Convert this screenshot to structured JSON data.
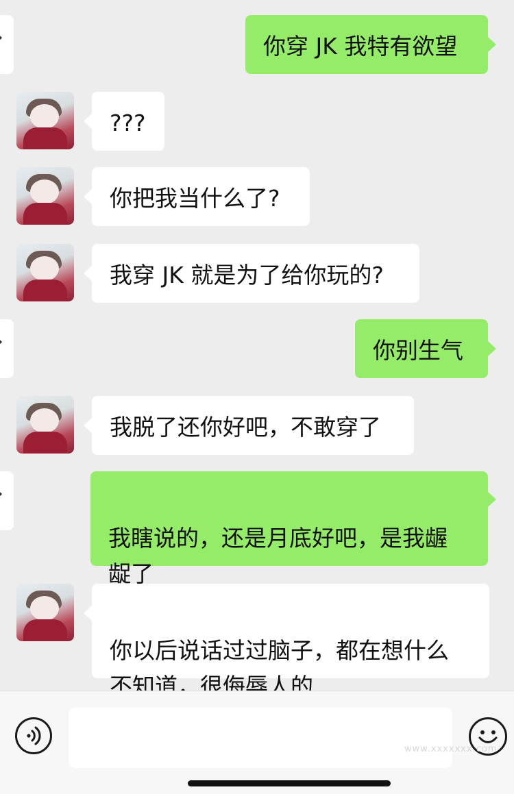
{
  "messages": [
    {
      "sender": "me",
      "text": "你穿 JK 我特有欲望"
    },
    {
      "sender": "other",
      "text": "???"
    },
    {
      "sender": "other",
      "text": "你把我当什么了?"
    },
    {
      "sender": "other",
      "text": "我穿 JK 就是为了给你玩的?"
    },
    {
      "sender": "me",
      "text": "你别生气"
    },
    {
      "sender": "other",
      "text": "我脱了还你好吧，不敢穿了"
    },
    {
      "sender": "me",
      "text": "我瞎说的，还是月底好吧，是我龌\n龊了"
    },
    {
      "sender": "other",
      "text": "你以后说话过过脑子，都在想什么\n不知道，很侮辱人的"
    }
  ],
  "edge_glyph": "❖",
  "input": {
    "placeholder": ""
  },
  "icons": {
    "voice": "voice-icon",
    "emoji": "emoji-icon"
  },
  "watermark": "www.xxxxxxx.com",
  "colors": {
    "background": "#ededed",
    "my_bubble": "#95ec69",
    "other_bubble": "#ffffff"
  }
}
